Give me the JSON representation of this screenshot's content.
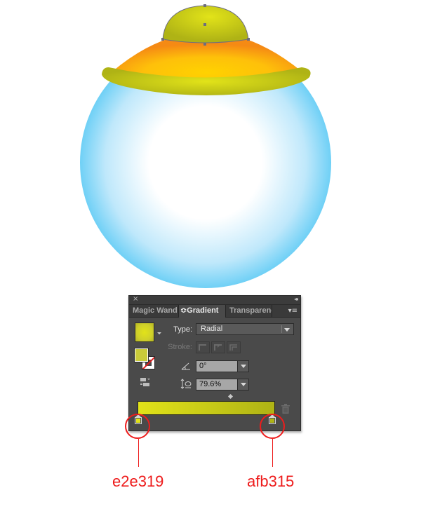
{
  "illustration": {
    "description": "blue glass orb with orange-yellow helmet cap and olive rim; top dome selected",
    "colors": {
      "orb_center": "#ffffff",
      "orb_edge": "#6fd0f6",
      "cap_center": "#ffd200",
      "cap_edge": "#f58a14",
      "rim_light": "#e2e319",
      "rim_dark": "#afb315",
      "selection_outline": "#6e6e7e"
    }
  },
  "panel": {
    "close_icon": "×",
    "collapse_icon": "◂◂",
    "tabs": [
      {
        "label": "Magic Wand",
        "active": false
      },
      {
        "label": "Gradient",
        "active": true,
        "prefix": "≎"
      },
      {
        "label": "Transparenc",
        "active": false
      }
    ],
    "menu_icon": "▾≡",
    "type_label": "Type:",
    "type_value": "Radial",
    "stroke_label": "Stroke:",
    "angle_value": "0°",
    "aspect_value": "79.6%",
    "gradient": {
      "start_color": "#e2e319",
      "end_color": "#afb315"
    }
  },
  "annotations": {
    "left_stop": "e2e319",
    "right_stop": "afb315",
    "color": "#ee1c1c"
  }
}
